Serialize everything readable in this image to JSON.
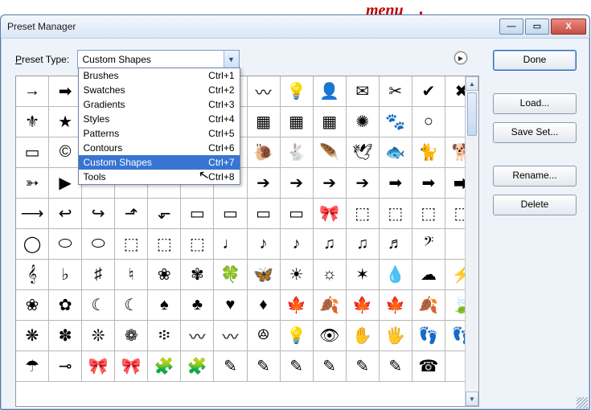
{
  "callout_label": "menu",
  "window": {
    "title": "Preset Manager"
  },
  "winbtns": {
    "min": "—",
    "max": "▭",
    "close": "X"
  },
  "preset_label_pre": "P",
  "preset_label_post": "reset Type:",
  "combo_value": "Custom Shapes",
  "dropdown": [
    {
      "label": "Brushes",
      "shortcut": "Ctrl+1",
      "sel": false
    },
    {
      "label": "Swatches",
      "shortcut": "Ctrl+2",
      "sel": false
    },
    {
      "label": "Gradients",
      "shortcut": "Ctrl+3",
      "sel": false
    },
    {
      "label": "Styles",
      "shortcut": "Ctrl+4",
      "sel": false
    },
    {
      "label": "Patterns",
      "shortcut": "Ctrl+5",
      "sel": false
    },
    {
      "label": "Contours",
      "shortcut": "Ctrl+6",
      "sel": false
    },
    {
      "label": "Custom Shapes",
      "shortcut": "Ctrl+7",
      "sel": true
    },
    {
      "label": "Tools",
      "shortcut": "Ctrl+8",
      "sel": false
    }
  ],
  "buttons": {
    "done": "Done",
    "load": "Load...",
    "saveset": "Save Set...",
    "rename": "Rename...",
    "delete": "Delete"
  },
  "fly_glyph": "▶",
  "combo_glyph": "▼",
  "scroll_up": "▲",
  "scroll_down": "▼",
  "shapes": [
    "→",
    "➡",
    "",
    "",
    "",
    "",
    "",
    "〰",
    "💡",
    "👤",
    "✉",
    "✂",
    "✔",
    "✖",
    "⚜",
    "★",
    "",
    "",
    "",
    "",
    "",
    "▦",
    "▦",
    "▦",
    "✺",
    "🐾",
    "○",
    "",
    "▭",
    "©",
    "",
    "",
    "",
    "",
    "",
    "🐌",
    "🐇",
    "🪶",
    "🕊",
    "🐟",
    "🐈",
    "🐕",
    "➳",
    "▶",
    "",
    "",
    "",
    "",
    "",
    "➔",
    "➔",
    "➔",
    "➔",
    "➡",
    "➡",
    "⮕",
    "⟶",
    "↩",
    "↪",
    "⬏",
    "⬐",
    "▭",
    "▭",
    "▭",
    "▭",
    "🎀",
    "⬚",
    "⬚",
    "⬚",
    "⬚",
    "◯",
    "⬭",
    "⬭",
    "⬚",
    "⬚",
    "⬚",
    "♩",
    "♪",
    "♪",
    "♫",
    "♫",
    "♬",
    "𝄢",
    "",
    "𝄞",
    "♭",
    "♯",
    "♮",
    "❀",
    "✾",
    "🍀",
    "🦋",
    "☀",
    "☼",
    "✶",
    "💧",
    "☁",
    "⚡",
    "❀",
    "✿",
    "☾",
    "☾",
    "♠",
    "♣",
    "♥",
    "♦",
    "🍁",
    "🍂",
    "🍁",
    "🍁",
    "🍂",
    "🍃",
    "❋",
    "✽",
    "❊",
    "❁",
    "፨",
    "〰",
    "〰",
    "ꔮ",
    "💡",
    "👁",
    "✋",
    "🖐",
    "👣",
    "👣",
    "☂",
    "⊸",
    "🎀",
    "🎀",
    "🧩",
    "🧩",
    "✎",
    "✎",
    "✎",
    "✎",
    "✎",
    "✎",
    "☎",
    ""
  ]
}
